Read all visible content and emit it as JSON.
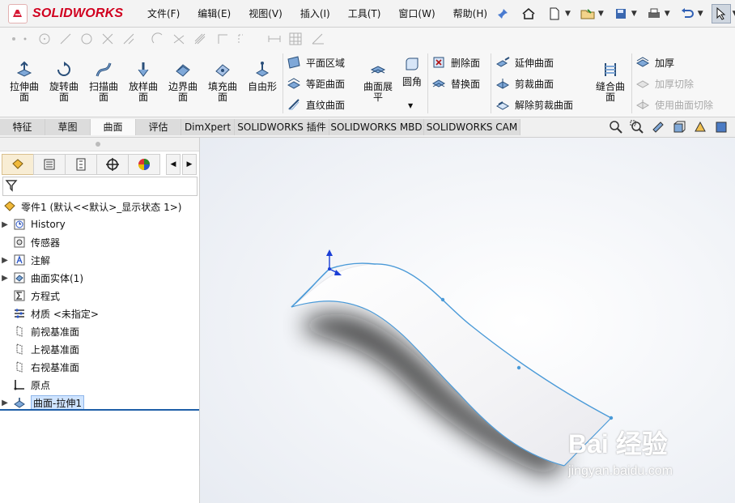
{
  "app": {
    "name": "SOLIDWORKS",
    "brand_color": "#d1001f"
  },
  "menu": [
    {
      "label": "文件(F)"
    },
    {
      "label": "编辑(E)"
    },
    {
      "label": "视图(V)"
    },
    {
      "label": "插入(I)"
    },
    {
      "label": "工具(T)"
    },
    {
      "label": "窗口(W)"
    },
    {
      "label": "帮助(H)"
    }
  ],
  "ribbon": {
    "big_buttons": [
      {
        "label": "拉伸曲\n面",
        "icon": "extrude-surface-icon"
      },
      {
        "label": "旋转曲\n面",
        "icon": "revolve-surface-icon"
      },
      {
        "label": "扫描曲\n面",
        "icon": "sweep-surface-icon"
      },
      {
        "label": "放样曲\n面",
        "icon": "loft-surface-icon"
      },
      {
        "label": "边界曲\n面",
        "icon": "boundary-surface-icon"
      },
      {
        "label": "填充曲\n面",
        "icon": "fill-surface-icon"
      },
      {
        "label": "自由形",
        "icon": "freeform-icon"
      }
    ],
    "col2": [
      {
        "label": "平面区域",
        "icon": "planar-surface-icon"
      },
      {
        "label": "等距曲面",
        "icon": "offset-surface-icon"
      },
      {
        "label": "直纹曲面",
        "icon": "ruled-surface-icon"
      }
    ],
    "surface_flatten": {
      "label": "曲面展\n平"
    },
    "fillet": {
      "label": "圆角"
    },
    "col3": [
      {
        "label": "删除面",
        "icon": "delete-face-icon"
      },
      {
        "label": "替换面",
        "icon": "replace-face-icon"
      }
    ],
    "col4": [
      {
        "label": "延伸曲面",
        "icon": "extend-surface-icon"
      },
      {
        "label": "剪裁曲面",
        "icon": "trim-surface-icon"
      },
      {
        "label": "解除剪裁曲面",
        "icon": "untrim-surface-icon"
      }
    ],
    "knit": {
      "label": "缝合曲\n面"
    },
    "col5": [
      {
        "label": "加厚",
        "enabled": true
      },
      {
        "label": "加厚切除",
        "enabled": false
      },
      {
        "label": "使用曲面切除",
        "enabled": false
      }
    ]
  },
  "tabs": [
    {
      "label": "特征"
    },
    {
      "label": "草图"
    },
    {
      "label": "曲面",
      "active": true
    },
    {
      "label": "评估"
    },
    {
      "label": "DimXpert"
    },
    {
      "label": "SOLIDWORKS 插件"
    },
    {
      "label": "SOLIDWORKS MBD"
    },
    {
      "label": "SOLIDWORKS CAM"
    }
  ],
  "tree": {
    "root": "零件1 (默认<<默认>_显示状态 1>)",
    "items": [
      {
        "label": "History",
        "expandable": true,
        "icon": "history-icon"
      },
      {
        "label": "传感器",
        "expandable": false,
        "icon": "sensor-icon"
      },
      {
        "label": "注解",
        "expandable": true,
        "icon": "annotation-icon"
      },
      {
        "label": "曲面实体(1)",
        "expandable": true,
        "icon": "surface-bodies-icon"
      },
      {
        "label": "方程式",
        "expandable": false,
        "icon": "equation-icon"
      },
      {
        "label": "材质 <未指定>",
        "expandable": false,
        "icon": "material-icon"
      },
      {
        "label": "前视基准面",
        "expandable": false,
        "icon": "plane-icon"
      },
      {
        "label": "上视基准面",
        "expandable": false,
        "icon": "plane-icon"
      },
      {
        "label": "右视基准面",
        "expandable": false,
        "icon": "plane-icon"
      },
      {
        "label": "原点",
        "expandable": false,
        "icon": "origin-icon"
      },
      {
        "label": "曲面-拉伸1",
        "expandable": true,
        "selected": true,
        "icon": "surface-extrude-icon"
      }
    ]
  },
  "watermark": {
    "top": "Bai 经验",
    "bottom": "jingyan.baidu.com"
  }
}
